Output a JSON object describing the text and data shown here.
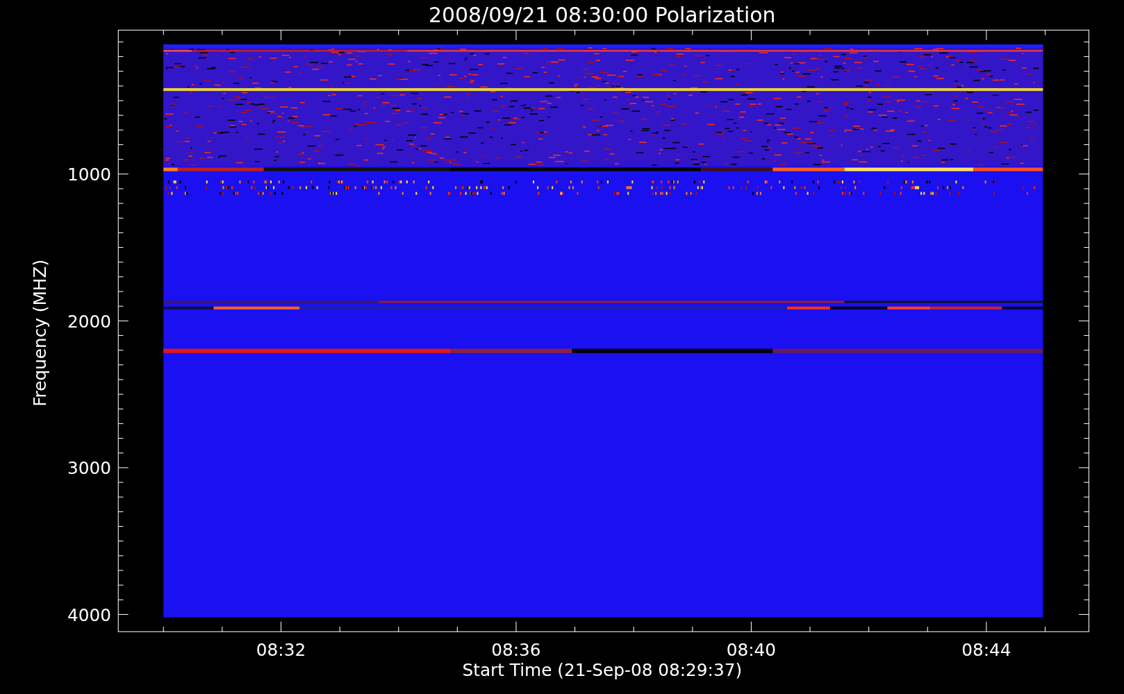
{
  "title": "2008/09/21 08:30:00 Polarization",
  "y_axis": {
    "label": "Frequency (MHZ)",
    "ticks": [
      "1000",
      "2000",
      "3000",
      "4000"
    ]
  },
  "x_axis": {
    "label": "Start Time (21-Sep-08 08:29:37)",
    "ticks": [
      "08:32",
      "08:36",
      "08:40",
      "08:44"
    ]
  }
}
